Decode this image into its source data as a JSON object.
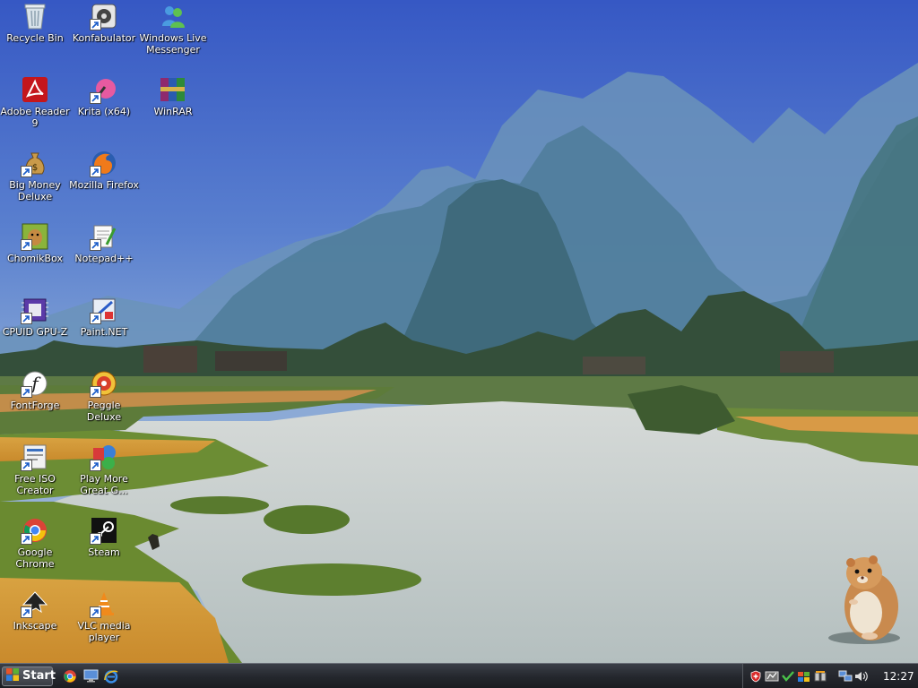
{
  "desktop": {
    "icons": [
      {
        "name": "recycle-bin",
        "label": "Recycle Bin",
        "shortcut": false
      },
      {
        "name": "konfabulator",
        "label": "Konfabulator",
        "shortcut": true
      },
      {
        "name": "windows-live-messenger",
        "label": "Windows Live Messenger",
        "shortcut": false
      },
      {
        "name": "adobe-reader",
        "label": "Adobe Reader 9",
        "shortcut": false
      },
      {
        "name": "krita",
        "label": "Krita (x64)",
        "shortcut": true
      },
      {
        "name": "winrar",
        "label": "WinRAR",
        "shortcut": false
      },
      {
        "name": "big-money-deluxe",
        "label": "Big Money Deluxe",
        "shortcut": true
      },
      {
        "name": "mozilla-firefox",
        "label": "Mozilla Firefox",
        "shortcut": true
      },
      {
        "name": "chomikbox",
        "label": "ChomikBox",
        "shortcut": true
      },
      {
        "name": "notepad-plus-plus",
        "label": "Notepad++",
        "shortcut": true
      },
      {
        "name": "cpuid-gpu-z",
        "label": "CPUID GPU-Z",
        "shortcut": true
      },
      {
        "name": "paint-net",
        "label": "Paint.NET",
        "shortcut": true
      },
      {
        "name": "fontforge",
        "label": "FontForge",
        "shortcut": true
      },
      {
        "name": "peggle-deluxe",
        "label": "Peggle Deluxe",
        "shortcut": true
      },
      {
        "name": "free-iso-creator",
        "label": "Free ISO Creator",
        "shortcut": true
      },
      {
        "name": "play-more-great-games",
        "label": "Play More Great G...",
        "shortcut": true
      },
      {
        "name": "google-chrome",
        "label": "Google Chrome",
        "shortcut": true
      },
      {
        "name": "steam",
        "label": "Steam",
        "shortcut": true
      },
      {
        "name": "inkscape",
        "label": "Inkscape",
        "shortcut": true
      },
      {
        "name": "vlc-media-player",
        "label": "VLC media player",
        "shortcut": true
      }
    ]
  },
  "taskbar": {
    "start_label": "Start",
    "quicklaunch": [
      "chrome-icon",
      "show-desktop-icon",
      "internet-explorer-icon"
    ],
    "tray_icons": [
      "antivirus-shield-icon",
      "network-monitor-icon",
      "security-center-icon",
      "windows-update-icon",
      "device-icon",
      "network-connection-icon",
      "volume-icon"
    ],
    "clock": "12:27"
  },
  "colors": {
    "sky_top": "#3a5fc8",
    "sky_mid": "#6f93d4",
    "mountain": "#5f89a8",
    "water": "#c7d0cd",
    "grass": "#6a8a3a",
    "field": "#d49a3c"
  }
}
